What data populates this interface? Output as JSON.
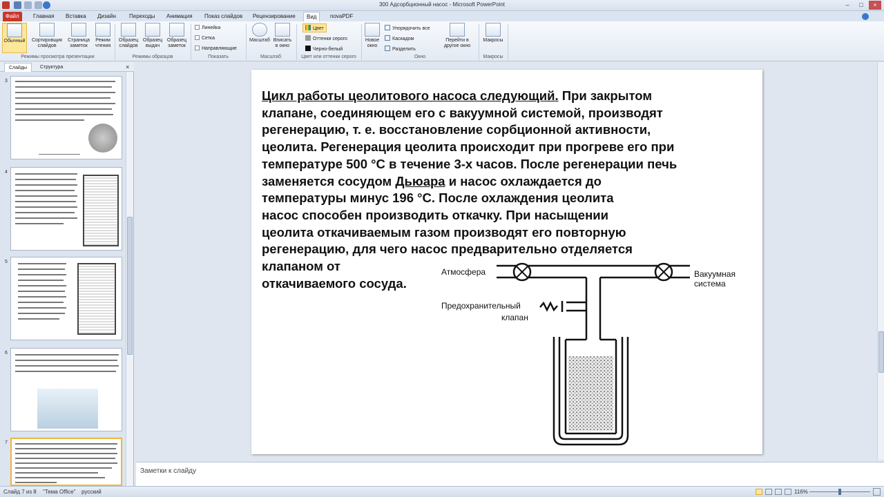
{
  "window": {
    "title": "300 Адсорбционный насос - Microsoft PowerPoint"
  },
  "tabs": [
    {
      "label": "Файл"
    },
    {
      "label": "Главная"
    },
    {
      "label": "Вставка"
    },
    {
      "label": "Дизайн"
    },
    {
      "label": "Переходы"
    },
    {
      "label": "Анимация"
    },
    {
      "label": "Показ слайдов"
    },
    {
      "label": "Рецензирование"
    },
    {
      "label": "Вид"
    },
    {
      "label": "novaPDF"
    }
  ],
  "ribbon": {
    "presentation_views": {
      "buttons": [
        "Обычный",
        "Сортировщик слайдов",
        "Страница заметок",
        "Режим чтения"
      ],
      "group_label": "Режимы просмотра презентации"
    },
    "master_views": {
      "buttons": [
        "Образец слайдов",
        "Образец выдач",
        "Образец заметок"
      ],
      "group_label": "Режимы образцов"
    },
    "show": {
      "checkboxes": [
        "Линейка",
        "Сетка",
        "Направляющие"
      ],
      "group_label": "Показать"
    },
    "zoom": {
      "buttons": [
        "Масштаб",
        "Вписать в окно"
      ],
      "group_label": "Масштаб"
    },
    "color": {
      "options": [
        "Цвет",
        "Оттенки серого",
        "Черно-белый"
      ],
      "group_label": "Цвет или оттенки серого"
    },
    "window": {
      "new_window": "Новое окно",
      "options": [
        "Упорядочить все",
        "Каскадом",
        "Разделить"
      ],
      "switch": "Перейти в другое окно",
      "group_label": "Окно"
    },
    "macros": {
      "button": "Макросы",
      "group_label": "Макросы"
    }
  },
  "left_panel": {
    "tabs": [
      "Слайды",
      "Структура"
    ],
    "slide_numbers": [
      "3",
      "4",
      "5",
      "6",
      "7"
    ]
  },
  "slide": {
    "heading": "Цикл работы цеолитового насоса следующий.",
    "lines": [
      " При закрытом",
      "клапане, соединяющем его с вакуумной системой, производят",
      "регенерацию, т. е. восстановление сорбционной активности,",
      "цеолита. Регенерация цеолита происходит при прогреве его при",
      "температуре 500 °С в течение 3-х часов. После регенерации печь",
      "заменяется сосудом ",
      "Дьюара",
      " и насос охлаждается до",
      "температуры минус 196 °С. После охлаждения цеолита",
      "насос способен производить откачку. При насыщении",
      "цеолита откачиваемым газом производят его повторную",
      "регенерацию, для чего насос предварительно отделяется",
      "клапаном от",
      "откачиваемого сосуда."
    ],
    "diagram": {
      "label_atmosphere": "Атмосфера",
      "label_vacuum_line1": "Вакуумная",
      "label_vacuum_line2": "система",
      "label_valve_line1": "Предохранительный",
      "label_valve_line2": "клапан"
    }
  },
  "notes": {
    "placeholder": "Заметки к слайду"
  },
  "status_bar": {
    "slide_info": "Слайд 7 из 8",
    "theme": "\"Тема Office\"",
    "language": "русский",
    "zoom": "116%"
  }
}
